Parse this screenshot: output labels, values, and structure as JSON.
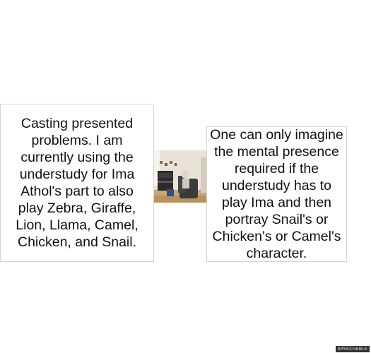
{
  "panels": {
    "left_text": "Casting presented problems. I am currently using the understudy for Ima Athol's part to also play Zebra, Giraffe, Lion, Llama, Camel, Chicken, and Snail.",
    "right_text": "One can only imagine the mental presence required if the understudy has to play Ima and then portray Snail's or Chicken's or Camel's character."
  },
  "photo": {
    "icon": "photo-room-with-piano-and-chair"
  },
  "watermark": {
    "text": "SPEECHABLE"
  }
}
